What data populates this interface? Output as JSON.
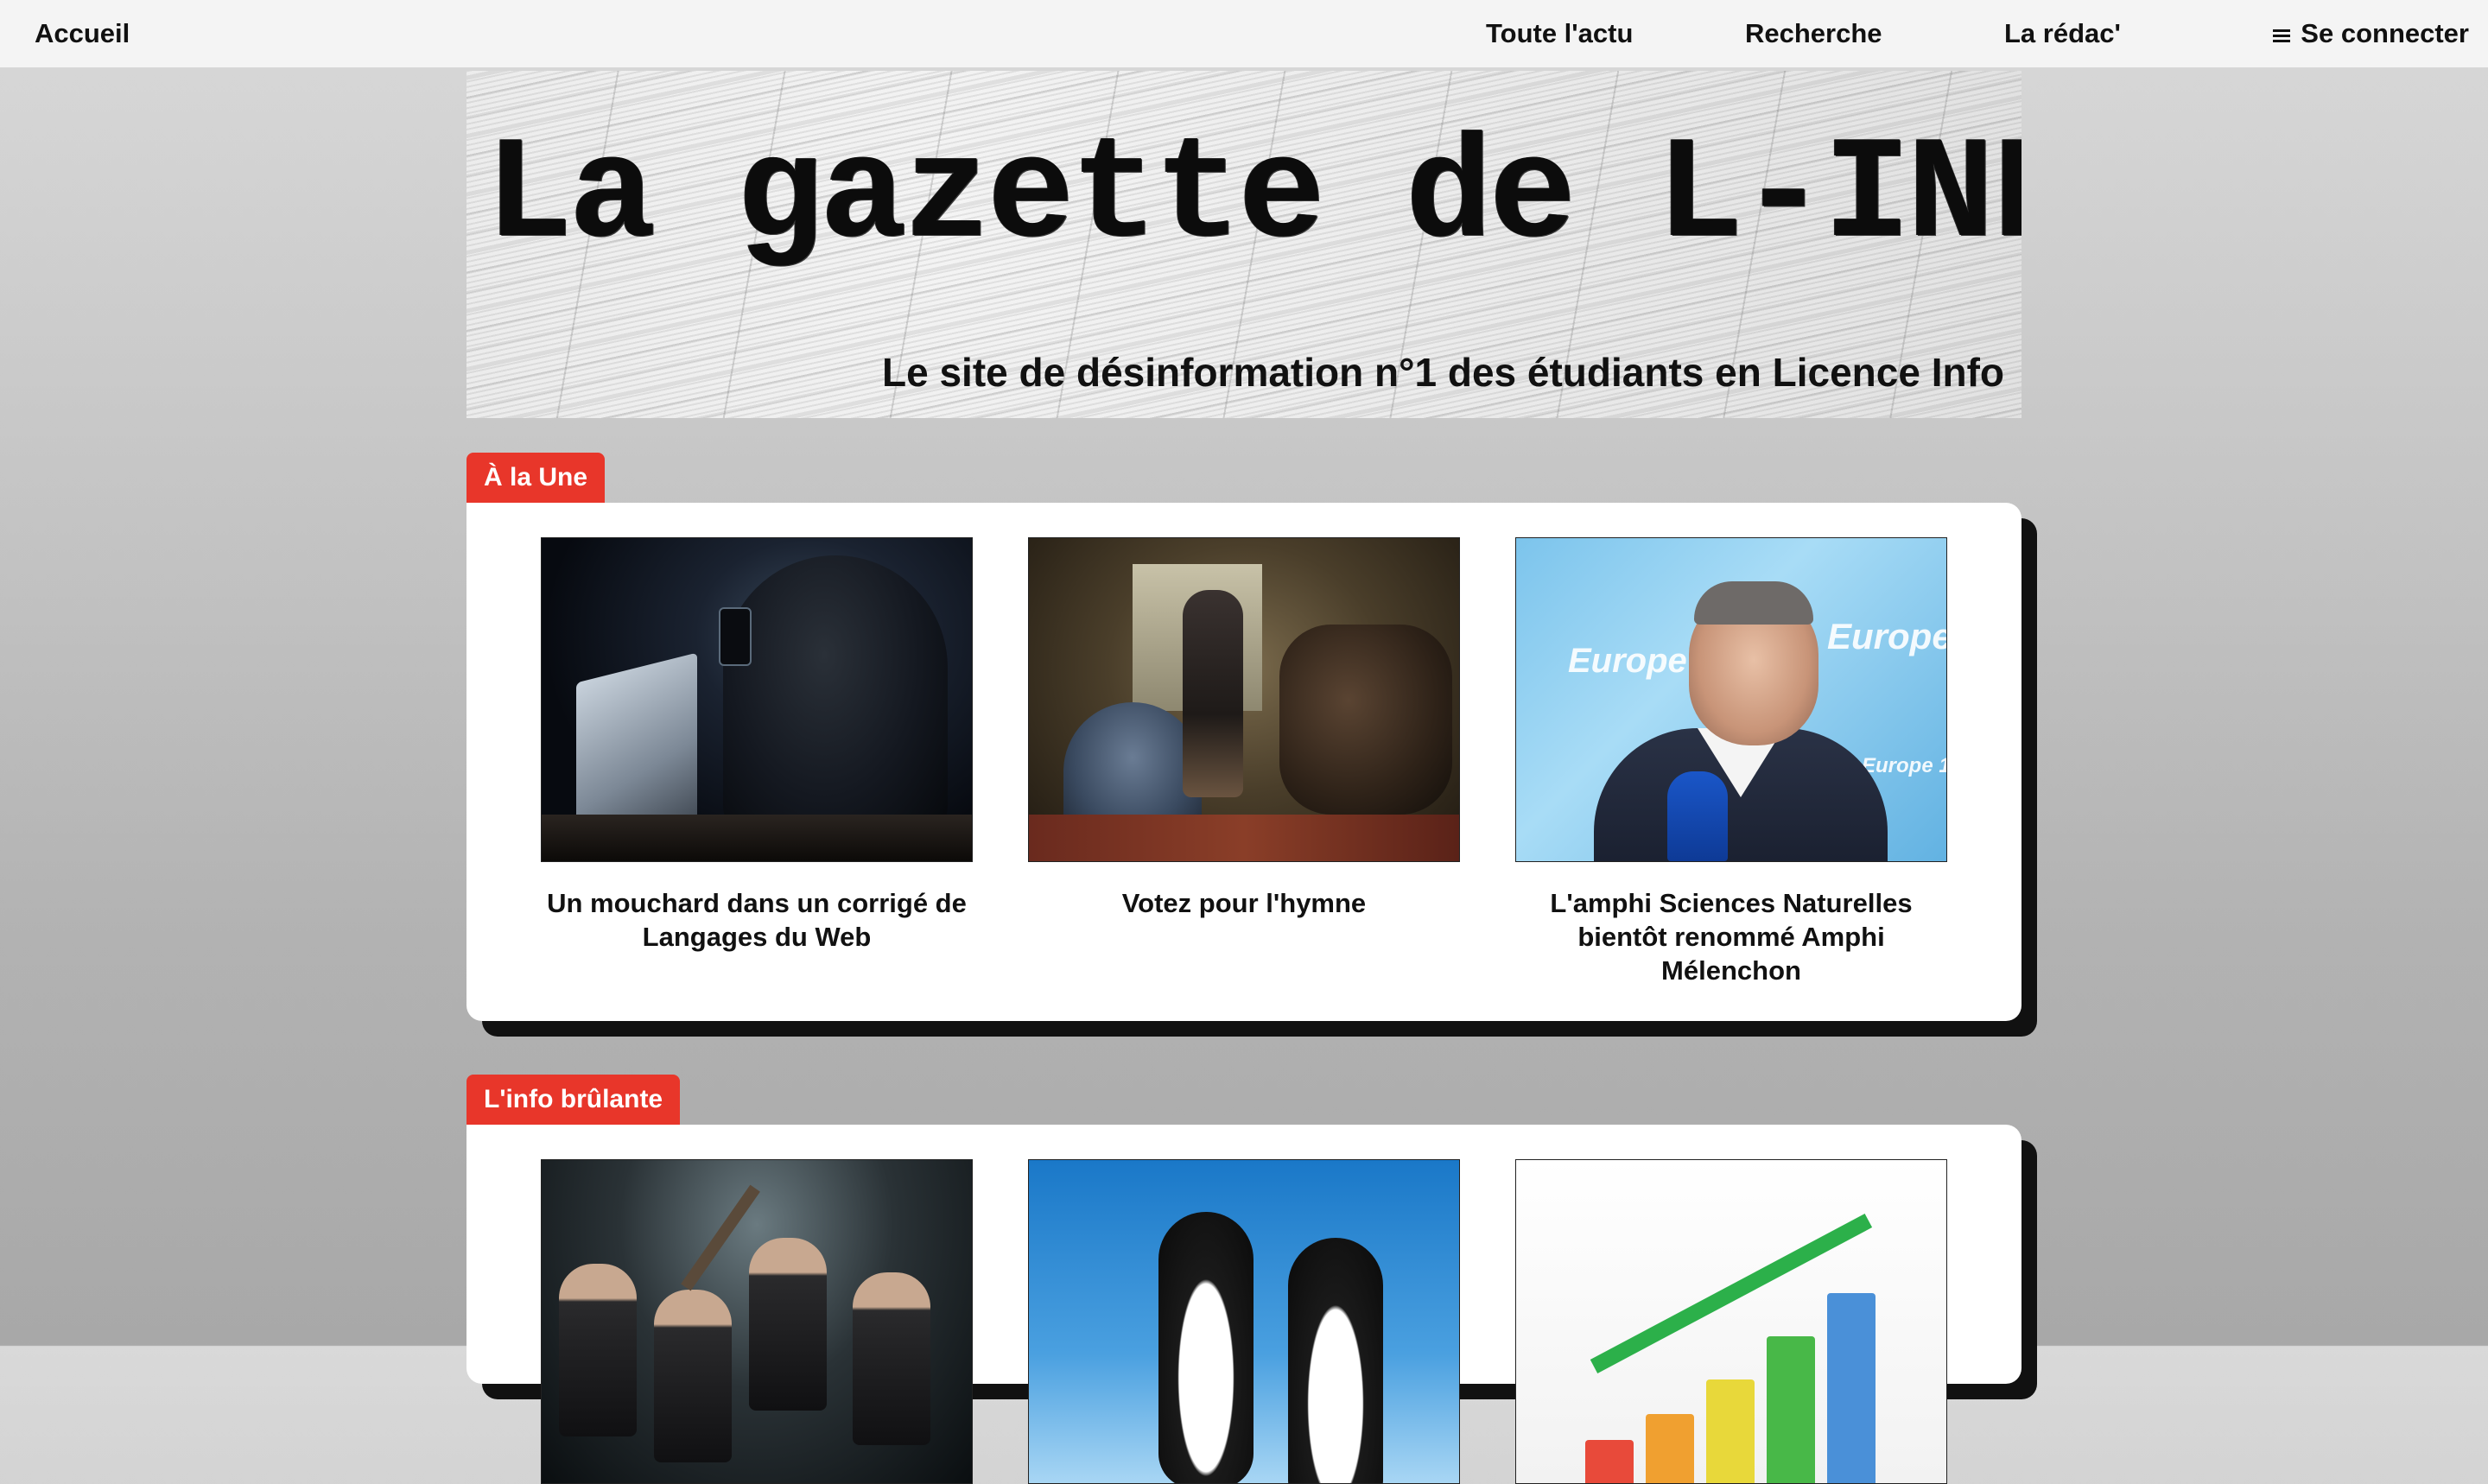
{
  "nav": {
    "home": "Accueil",
    "all_news": "Toute l'actu",
    "search": "Recherche",
    "team": "La rédac'",
    "login": "Se connecter",
    "menu_icon": "menu-icon"
  },
  "banner": {
    "title": "La gazette de L-INFO",
    "subtitle": "Le site de désinformation n°1 des étudiants en Licence Info"
  },
  "sections": [
    {
      "tag": "À la Une",
      "articles": [
        {
          "title": "Un mouchard dans un corrigé de Langages du Web"
        },
        {
          "title": "Votez pour l'hymne"
        },
        {
          "title": "L'amphi Sciences Naturelles bientôt renommé Amphi Mélenchon"
        }
      ]
    },
    {
      "tag": "L'info brûlante",
      "articles": [
        {
          "title": ""
        },
        {
          "title": ""
        },
        {
          "title": ""
        }
      ]
    }
  ],
  "thumb_texts": {
    "europe1": "Europe 1"
  },
  "colors": {
    "accent": "#e8362a",
    "nav_bg": "#f4f4f4",
    "card_bg": "#ffffff",
    "card_shadow": "#111111"
  }
}
